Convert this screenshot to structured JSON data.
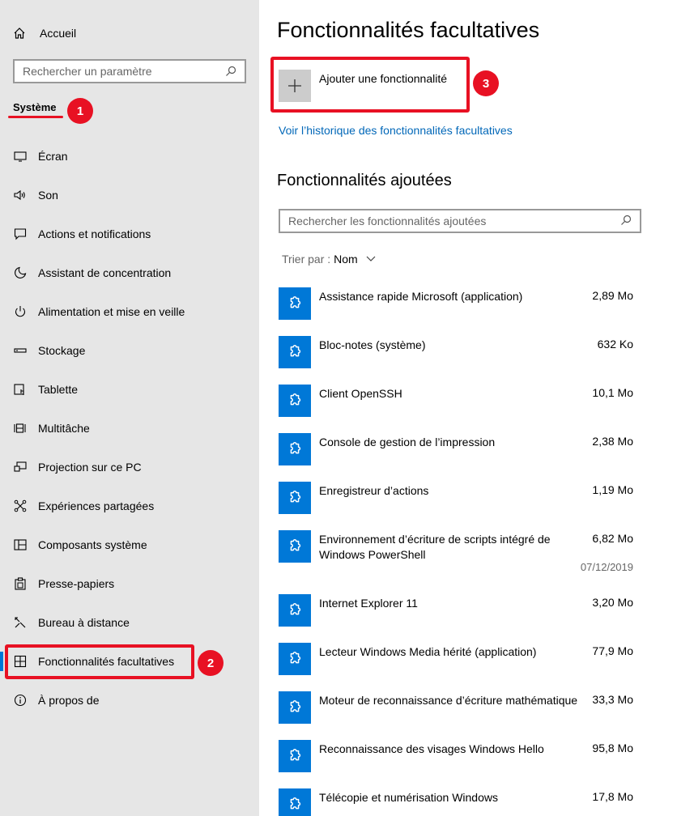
{
  "sidebar": {
    "home_label": "Accueil",
    "search_placeholder": "Rechercher un paramètre",
    "section_label": "Système",
    "items": [
      {
        "label": "Écran",
        "icon": "monitor-icon"
      },
      {
        "label": "Son",
        "icon": "speaker-icon"
      },
      {
        "label": "Actions et notifications",
        "icon": "notification-icon"
      },
      {
        "label": "Assistant de concentration",
        "icon": "moon-icon"
      },
      {
        "label": "Alimentation et mise en veille",
        "icon": "power-icon"
      },
      {
        "label": "Stockage",
        "icon": "storage-icon"
      },
      {
        "label": "Tablette",
        "icon": "tablet-icon"
      },
      {
        "label": "Multitâche",
        "icon": "multitask-icon"
      },
      {
        "label": "Projection sur ce PC",
        "icon": "projection-icon"
      },
      {
        "label": "Expériences partagées",
        "icon": "shared-icon"
      },
      {
        "label": "Composants système",
        "icon": "components-icon"
      },
      {
        "label": "Presse-papiers",
        "icon": "clipboard-icon"
      },
      {
        "label": "Bureau à distance",
        "icon": "remote-desktop-icon"
      },
      {
        "label": "Fonctionnalités facultatives",
        "icon": "optional-features-icon",
        "active": true
      },
      {
        "label": "À propos de",
        "icon": "info-icon"
      }
    ]
  },
  "annotations": [
    "1",
    "2",
    "3"
  ],
  "main": {
    "title": "Fonctionnalités facultatives",
    "add_label": "Ajouter une fonctionnalité",
    "history_link": "Voir l’historique des fonctionnalités facultatives",
    "added_heading": "Fonctionnalités ajoutées",
    "search_placeholder": "Rechercher les fonctionnalités ajoutées",
    "sort_label": "Trier par :",
    "sort_value": "Nom",
    "features": [
      {
        "name": "Assistance rapide Microsoft (application)",
        "size": "2,89 Mo"
      },
      {
        "name": "Bloc-notes (système)",
        "size": "632 Ko"
      },
      {
        "name": "Client OpenSSH",
        "size": "10,1 Mo"
      },
      {
        "name": "Console de gestion de l’impression",
        "size": "2,38 Mo"
      },
      {
        "name": "Enregistreur d’actions",
        "size": "1,19 Mo"
      },
      {
        "name": "Environnement d’écriture de scripts intégré de Windows PowerShell",
        "size": "6,82 Mo",
        "date": "07/12/2019"
      },
      {
        "name": "Internet Explorer 11",
        "size": "3,20 Mo"
      },
      {
        "name": "Lecteur Windows Media hérité (application)",
        "size": "77,9 Mo"
      },
      {
        "name": "Moteur de reconnaissance d’écriture mathématique",
        "size": "33,3 Mo"
      },
      {
        "name": "Reconnaissance des visages Windows Hello",
        "size": "95,8 Mo"
      },
      {
        "name": "Télécopie et numérisation Windows",
        "size": "17,8 Mo"
      }
    ]
  },
  "colors": {
    "accent": "#0078d7",
    "annotation": "#e81123",
    "link": "#0067b8"
  }
}
